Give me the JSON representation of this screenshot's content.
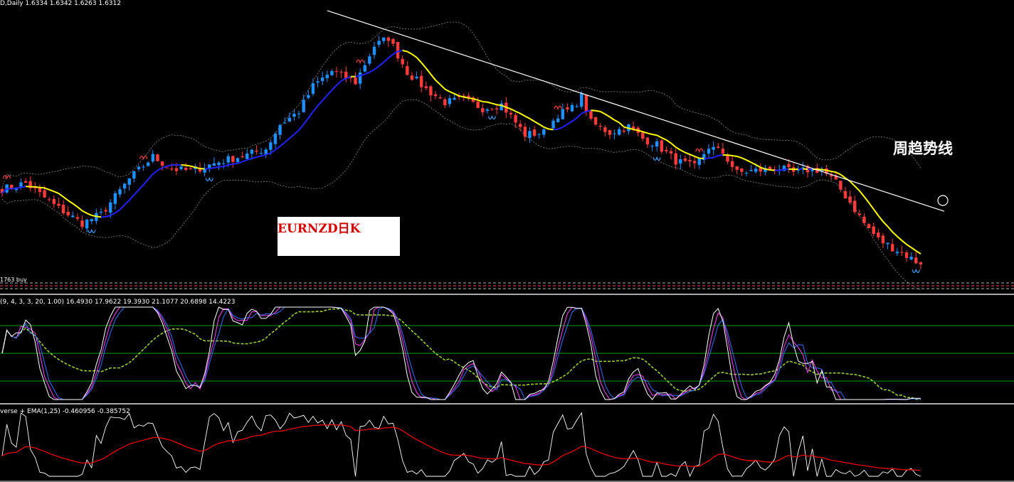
{
  "header": {
    "symbol_info": "D,Daily  1.6334 1.6342 1.6263 1.6312",
    "open_buy_label": "1763 buy"
  },
  "annotations": {
    "weekly_trendline_label": "周趋势线",
    "chart_caption": "EURNZD日K"
  },
  "indicator1": {
    "label": "(9, 4, 3, 3, 20, 1.00) 16.4930 17.9622 19.3930 21.1077 20.6898 14.4223",
    "levels": [
      80,
      50,
      20
    ]
  },
  "indicator2": {
    "label": "verse + EMA(1,25) -0.460956 -0.385752"
  },
  "colors": {
    "background": "#000000",
    "bull_candle": "#1e90ff",
    "bear_candle": "#ff3b3b",
    "ma_up": "#2222ff",
    "ma_down": "#ffff00",
    "bands": "#8a8a8a",
    "trendline": "#ffffff",
    "stoch_white": "#ffffff",
    "stoch_blue": "#3a6dff",
    "stoch_pink": "#ff40ff",
    "stoch_green": "#9acd32",
    "level_line": "#00a000",
    "osc_line": "#ffffff",
    "ema_line": "#ff0000",
    "fractal_top": "#ff4040",
    "fractal_bottom": "#40a0ff"
  },
  "chart_data": {
    "type": "candlestick",
    "title": "EURNZD日K",
    "timeframe": "Daily",
    "last_bar": {
      "open": 1.6334,
      "high": 1.6342,
      "low": 1.6263,
      "close": 1.6312
    },
    "close_anchors": [
      [
        0,
        1.706
      ],
      [
        5,
        1.712
      ],
      [
        11,
        1.69
      ],
      [
        17,
        1.672
      ],
      [
        21,
        1.681
      ],
      [
        27,
        1.716
      ],
      [
        32,
        1.738
      ],
      [
        36,
        1.726
      ],
      [
        40,
        1.724
      ],
      [
        46,
        1.733
      ],
      [
        52,
        1.74
      ],
      [
        56,
        1.746
      ],
      [
        59,
        1.77
      ],
      [
        63,
        1.783
      ],
      [
        66,
        1.808
      ],
      [
        70,
        1.823
      ],
      [
        75,
        1.812
      ],
      [
        79,
        1.848
      ],
      [
        82,
        1.856
      ],
      [
        86,
        1.822
      ],
      [
        90,
        1.805
      ],
      [
        94,
        1.792
      ],
      [
        98,
        1.795
      ],
      [
        102,
        1.786
      ],
      [
        106,
        1.79
      ],
      [
        111,
        1.76
      ],
      [
        115,
        1.762
      ],
      [
        118,
        1.78
      ],
      [
        121,
        1.786
      ],
      [
        123,
        1.798
      ],
      [
        125,
        1.772
      ],
      [
        129,
        1.762
      ],
      [
        133,
        1.768
      ],
      [
        136,
        1.756
      ],
      [
        139,
        1.75
      ],
      [
        143,
        1.734
      ],
      [
        147,
        1.728
      ],
      [
        150,
        1.748
      ],
      [
        153,
        1.742
      ],
      [
        156,
        1.722
      ],
      [
        159,
        1.724
      ],
      [
        162,
        1.725
      ],
      [
        165,
        1.727
      ],
      [
        168,
        1.722
      ],
      [
        171,
        1.725
      ],
      [
        174,
        1.725
      ],
      [
        177,
        1.712
      ],
      [
        180,
        1.693
      ],
      [
        183,
        1.672
      ],
      [
        186,
        1.656
      ],
      [
        189,
        1.648
      ],
      [
        192,
        1.64
      ],
      [
        195,
        1.631
      ]
    ],
    "bar_count": 196,
    "weekly_trendline": {
      "start": [
        69,
        1.883
      ],
      "end": [
        200,
        1.684
      ]
    }
  }
}
